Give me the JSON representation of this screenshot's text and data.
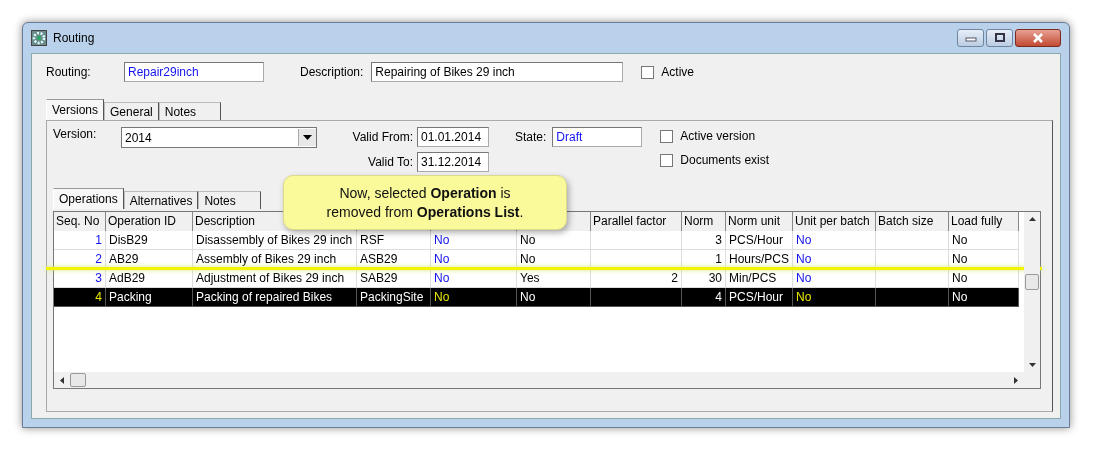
{
  "window": {
    "title": "Routing"
  },
  "header": {
    "routing_label": "Routing:",
    "routing": "Repair29inch",
    "description_label": "Description:",
    "description": "Repairing of Bikes 29 inch",
    "active": {
      "label": "Active",
      "checked": false
    }
  },
  "tabs": [
    {
      "label": "Versions",
      "selected": true
    },
    {
      "label": "General",
      "selected": false
    },
    {
      "label": "Notes",
      "selected": false
    }
  ],
  "version": {
    "version_label": "Version:",
    "version": "2014",
    "valid_from_label": "Valid From:",
    "valid_from": "01.01.2014",
    "valid_to_label": "Valid To:",
    "valid_to": "31.12.2014",
    "state_label": "State:",
    "state": "Draft",
    "checkboxes": [
      {
        "label": "Active version",
        "checked": false
      },
      {
        "label": "Documents exist",
        "checked": false
      }
    ]
  },
  "inner_tabs": [
    {
      "label": "Operations",
      "selected": true
    },
    {
      "label": "Alternatives",
      "selected": false
    },
    {
      "label": "Notes",
      "selected": false
    }
  ],
  "table": {
    "columns": [
      {
        "label": "Seq. No",
        "numeric": true,
        "accent": true
      },
      {
        "label": "Operation ID"
      },
      {
        "label": "Description"
      },
      {
        "covered": true
      },
      {
        "covered": true,
        "accent": true
      },
      {
        "covered": true
      },
      {
        "label": "Parallel factor",
        "numeric": true
      },
      {
        "label": "Norm",
        "numeric": true
      },
      {
        "label": "Norm unit"
      },
      {
        "label": "Unit per batch",
        "accent": true
      },
      {
        "label": "Batch size"
      },
      {
        "label": "Load fully"
      }
    ],
    "rows": [
      {
        "selected": false,
        "cells": [
          "1",
          "DisB29",
          "Disassembly of Bikes 29 inch",
          "RSF",
          "No",
          "No",
          null,
          "3",
          "PCS/Hour",
          "No",
          null,
          "No"
        ]
      },
      {
        "selected": false,
        "cells": [
          "2",
          "AB29",
          "Assembly of Bikes 29 inch",
          "ASB29",
          "No",
          "No",
          null,
          "1",
          "Hours/PCS",
          "No",
          null,
          "No"
        ]
      },
      {
        "selected": false,
        "cells": [
          "3",
          "AdB29",
          "Adjustment of Bikes 29 inch",
          "SAB29",
          "No",
          "Yes",
          "2",
          "30",
          "Min/PCS",
          "No",
          null,
          "No"
        ]
      },
      {
        "selected": true,
        "cells": [
          "4",
          "Packing",
          "Packing of repaired Bikes",
          "PackingSite",
          "No",
          "No",
          null,
          "4",
          "PCS/Hour",
          "No",
          null,
          "No"
        ]
      }
    ]
  },
  "callout": "Now, selected **Operation** is removed from **Operations List**."
}
